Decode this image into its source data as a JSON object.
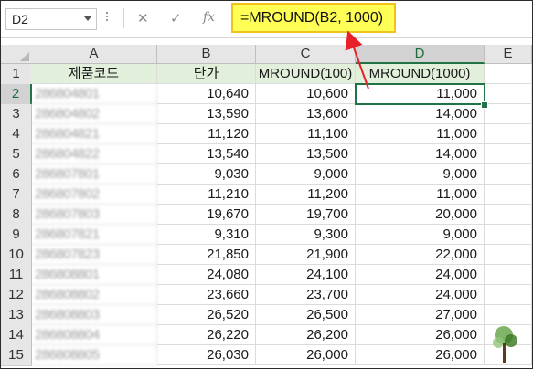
{
  "formula_bar": {
    "name_box": "D2",
    "cancel_icon": "✕",
    "enter_icon": "✓",
    "fx_icon": "fx",
    "formula": "=MROUND(B2, 1000)"
  },
  "columns": [
    "A",
    "B",
    "C",
    "D",
    "E"
  ],
  "rows": [
    "1",
    "2",
    "3",
    "4",
    "5",
    "6",
    "7",
    "8",
    "9",
    "10",
    "11",
    "12",
    "13",
    "14",
    "15"
  ],
  "headers": {
    "a": "제품코드",
    "b": "단가",
    "c": "MROUND(100)",
    "d": "MROUND(1000)"
  },
  "data": [
    {
      "code": "286804801",
      "price": "10,640",
      "mround100": "10,600",
      "mround1000": "11,000"
    },
    {
      "code": "286804802",
      "price": "13,590",
      "mround100": "13,600",
      "mround1000": "14,000"
    },
    {
      "code": "286804821",
      "price": "11,120",
      "mround100": "11,100",
      "mround1000": "11,000"
    },
    {
      "code": "286804822",
      "price": "13,540",
      "mround100": "13,500",
      "mround1000": "14,000"
    },
    {
      "code": "286807801",
      "price": "9,030",
      "mround100": "9,000",
      "mround1000": "9,000"
    },
    {
      "code": "286807802",
      "price": "11,210",
      "mround100": "11,200",
      "mround1000": "11,000"
    },
    {
      "code": "286807803",
      "price": "19,670",
      "mround100": "19,700",
      "mround1000": "20,000"
    },
    {
      "code": "286807821",
      "price": "9,310",
      "mround100": "9,300",
      "mround1000": "9,000"
    },
    {
      "code": "286807823",
      "price": "21,850",
      "mround100": "21,900",
      "mround1000": "22,000"
    },
    {
      "code": "286808801",
      "price": "24,080",
      "mround100": "24,100",
      "mround1000": "24,000"
    },
    {
      "code": "286808802",
      "price": "23,660",
      "mround100": "23,700",
      "mround1000": "24,000"
    },
    {
      "code": "286808803",
      "price": "26,520",
      "mround100": "26,500",
      "mround1000": "27,000"
    },
    {
      "code": "286808804",
      "price": "26,220",
      "mround100": "26,200",
      "mround1000": "26,000"
    },
    {
      "code": "286808805",
      "price": "26,030",
      "mround100": "26,000",
      "mround1000": "26,000"
    }
  ],
  "selected_cell": "D2",
  "colors": {
    "header_fill": "#e2efda",
    "formula_highlight": "#ffff55",
    "arrow": "#e8202a",
    "selection": "#217346"
  }
}
